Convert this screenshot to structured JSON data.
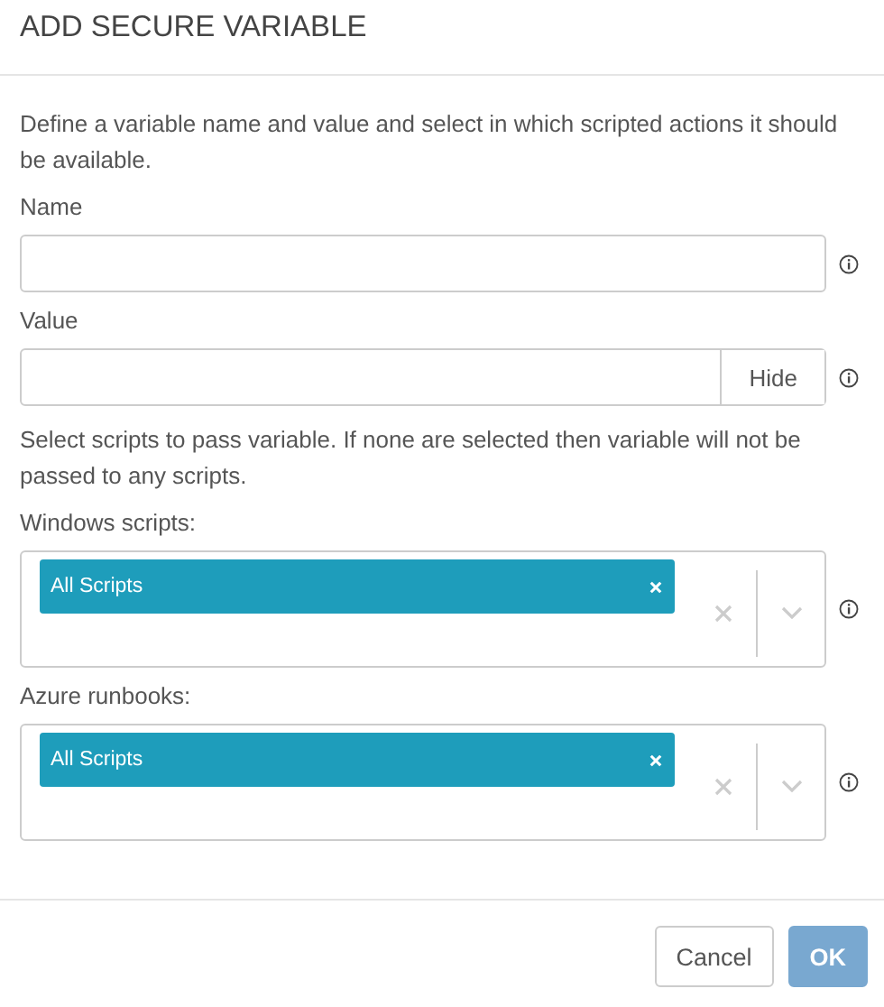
{
  "dialog": {
    "title": "ADD SECURE VARIABLE"
  },
  "description": "Define a variable name and value and select in which scripted actions it should be available.",
  "name_field": {
    "label": "Name"
  },
  "value_field": {
    "label": "Value",
    "toggle": "Hide"
  },
  "scripts_note": "Select scripts to pass variable. If none are selected then variable will not be passed to any scripts.",
  "selects": [
    {
      "label": "Windows scripts:",
      "tags": [
        "All Scripts"
      ]
    },
    {
      "label": "Azure runbooks:",
      "tags": [
        "All Scripts"
      ]
    }
  ],
  "buttons": [
    {
      "label": "Cancel",
      "kind": "secondary",
      "disabled": false
    },
    {
      "label": "OK",
      "kind": "primary",
      "disabled": true
    }
  ]
}
